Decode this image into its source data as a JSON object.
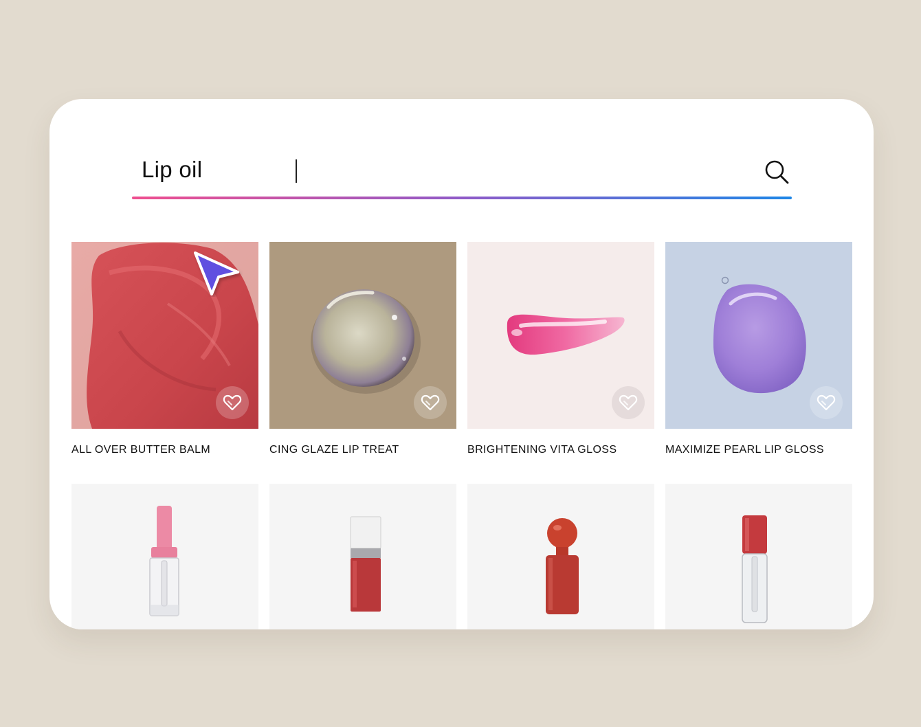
{
  "search": {
    "value": "Lip oil",
    "icon": "search-icon",
    "gradient": [
      "#ef4f8f",
      "#8f5ac8",
      "#1e86e6"
    ]
  },
  "colors": {
    "background": "#e2dbcf",
    "cursor": "#6150e0",
    "heart_bg": "rgba(255,255,255,0.22)"
  },
  "products": [
    {
      "title": "ALL OVER BUTTER BALM",
      "favorite_icon": "heart-icon"
    },
    {
      "title": "CING GLAZE LIP TREAT",
      "favorite_icon": "heart-icon"
    },
    {
      "title": "BRIGHTENING VITA GLOSS",
      "favorite_icon": "heart-icon"
    },
    {
      "title": "MAXIMIZE PEARL LIP GLOSS",
      "favorite_icon": "heart-icon"
    }
  ],
  "second_row": [
    {
      "icon": "pink-lip-oil-bottle"
    },
    {
      "icon": "red-lip-tint-bottle"
    },
    {
      "icon": "red-ball-cap-bottle"
    },
    {
      "icon": "clear-red-cap-bottle"
    }
  ]
}
